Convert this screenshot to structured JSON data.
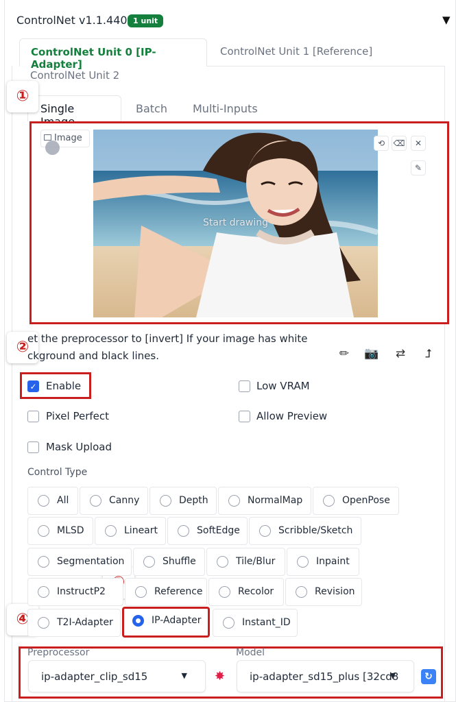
{
  "header": {
    "title": "ControlNet v1.1.440",
    "badge": "1 unit",
    "collapse_icon": "triangle-down-icon"
  },
  "unit_tabs": [
    "ControlNet Unit 0 [IP-Adapter]",
    "ControlNet Unit 1 [Reference]",
    "ControlNet Unit 2"
  ],
  "input_tabs": [
    "Single Image",
    "Batch",
    "Multi-Inputs"
  ],
  "image_panel": {
    "label": "Image",
    "overlay_text": "Start drawing",
    "tools": [
      "undo-icon",
      "eraser-icon",
      "close-icon",
      "brush-icon"
    ]
  },
  "markers": [
    "①",
    "②",
    "③",
    "④"
  ],
  "hint": {
    "line1": "et the preprocessor to [invert] If your image has white",
    "line2": "ckground and black lines."
  },
  "action_buttons": [
    "edit-icon",
    "camera-icon",
    "swap-icon",
    "send-up-icon"
  ],
  "checkboxes": [
    {
      "label": "Enable",
      "checked": true
    },
    {
      "label": "Low VRAM",
      "checked": false
    },
    {
      "label": "Pixel Perfect",
      "checked": false
    },
    {
      "label": "Allow Preview",
      "checked": false
    },
    {
      "label": "Mask Upload",
      "checked": false
    }
  ],
  "control_type": {
    "label": "Control Type",
    "selected": "IP-Adapter",
    "options": [
      "All",
      "Canny",
      "Depth",
      "NormalMap",
      "OpenPose",
      "MLSD",
      "Lineart",
      "SoftEdge",
      "Scribble/Sketch",
      "Segmentation",
      "Shuffle",
      "Tile/Blur",
      "Inpaint",
      "InstructP2",
      "Reference",
      "Recolor",
      "Revision",
      "T2I-Adapter",
      "IP-Adapter",
      "Instant_ID"
    ]
  },
  "preprocessor": {
    "label": "Preprocessor",
    "value": "ip-adapter_clip_sd15"
  },
  "model": {
    "label": "Model",
    "value": "ip-adapter_sd15_plus [32cd8"
  },
  "colors": {
    "accent_green": "#15803d",
    "highlight_red": "#c81e1e",
    "check_blue": "#2563eb"
  }
}
